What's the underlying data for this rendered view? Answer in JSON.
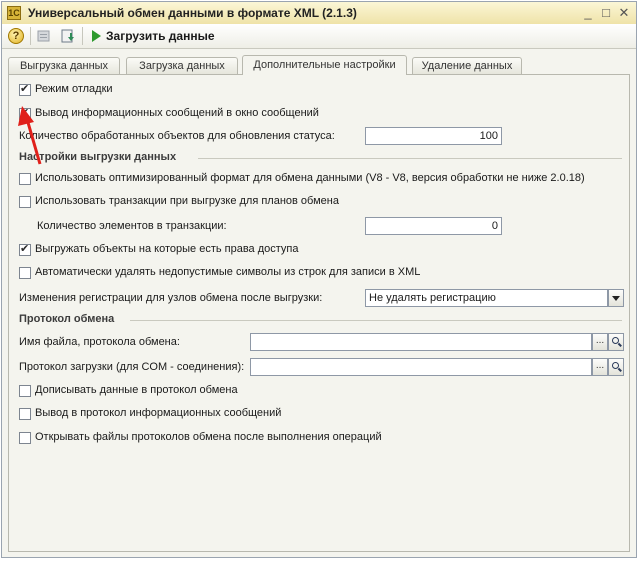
{
  "window": {
    "title": "Универсальный обмен данными в формате XML (2.1.3)",
    "app_icon_letter": "1С",
    "controls": {
      "minimize": "_",
      "maximize": "□",
      "close": "✕"
    }
  },
  "toolbar": {
    "help_label": "?",
    "load_label": "Загрузить данные"
  },
  "tabs": [
    {
      "label": "Выгрузка данных"
    },
    {
      "label": "Загрузка данных"
    },
    {
      "label": "Дополнительные настройки"
    },
    {
      "label": "Удаление данных"
    }
  ],
  "active_tab": "Дополнительные настройки",
  "settings": {
    "debug_mode": {
      "label": "Режим отладки",
      "checked": true
    },
    "messages_to_window": {
      "label": "Вывод информационных сообщений в окно сообщений",
      "checked": true
    },
    "objects_count": {
      "label": "Количество обработанных объектов для обновления статуса:",
      "value": "100"
    }
  },
  "export_settings": {
    "header": "Настройки выгрузки данных",
    "optimized_format": {
      "label": "Использовать оптимизированный формат для обмена данными (V8 - V8, версия обработки не ниже 2.0.18)",
      "checked": false
    },
    "use_transactions": {
      "label": "Использовать транзакции при выгрузке для планов обмена",
      "checked": false
    },
    "transaction_count": {
      "label": "Количество элементов в транзакции:",
      "value": "0"
    },
    "export_with_rights": {
      "label": "Выгружать объекты на которые есть права доступа",
      "checked": true
    },
    "auto_remove_symbols": {
      "label": "Автоматически удалять недопустимые символы из строк для записи в XML",
      "checked": false
    },
    "registration_changes": {
      "label": "Изменения регистрации для узлов обмена после выгрузки:",
      "value": "Не удалять регистрацию"
    }
  },
  "protocol": {
    "header": "Протокол обмена",
    "file_name": {
      "label": "Имя файла, протокола обмена:",
      "value": ""
    },
    "load_protocol": {
      "label": "Протокол загрузки (для COM - соединения):",
      "value": ""
    },
    "append_data": {
      "label": "Дописывать данные в протокол обмена",
      "checked": false
    },
    "info_messages": {
      "label": "Вывод в протокол информационных сообщений",
      "checked": false
    },
    "open_files": {
      "label": "Открывать файлы протоколов обмена после выполнения операций",
      "checked": false
    },
    "browse_label": "..."
  },
  "colors": {
    "titlebar": "#efe3a8",
    "section_text": "#3c3c3c",
    "annotation_arrow": "#e0201a"
  }
}
